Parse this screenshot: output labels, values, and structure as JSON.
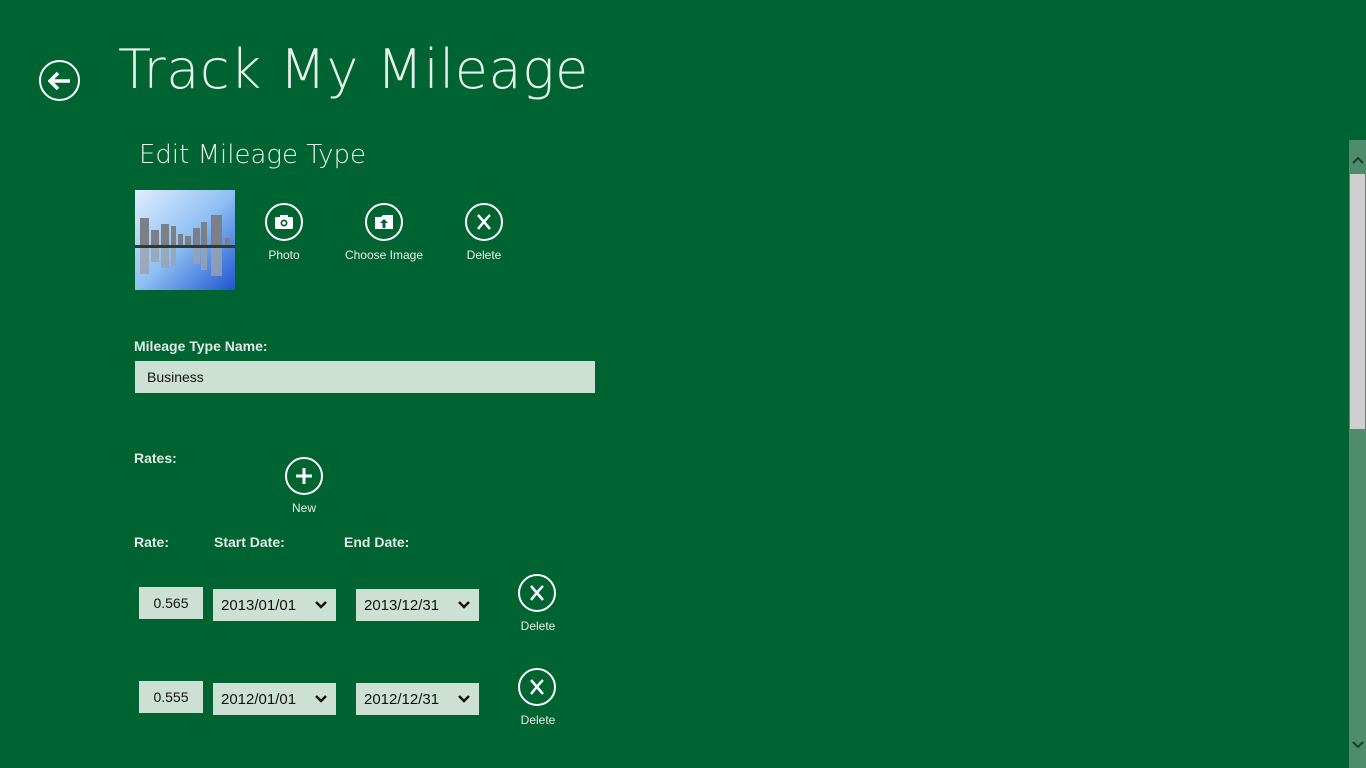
{
  "header": {
    "app_title": "Track My Mileage",
    "back_icon": "back-arrow-icon"
  },
  "page": {
    "section_title": "Edit Mileage Type"
  },
  "image_actions": {
    "thumbnail_alt": "City skyline reflected in water",
    "photo_label": "Photo",
    "choose_image_label": "Choose Image",
    "delete_label": "Delete"
  },
  "form": {
    "name_label": "Mileage Type Name:",
    "name_value": "Business",
    "rates_label": "Rates:",
    "new_label": "New",
    "columns": {
      "rate": "Rate:",
      "start_date": "Start Date:",
      "end_date": "End Date:"
    },
    "rates": [
      {
        "rate": "0.565",
        "start_date": "2013/01/01",
        "end_date": "2013/12/31",
        "delete_label": "Delete"
      },
      {
        "rate": "0.555",
        "start_date": "2012/01/01",
        "end_date": "2012/12/31",
        "delete_label": "Delete"
      }
    ]
  },
  "colors": {
    "background": "#006432",
    "input_fill": "#cce0d4",
    "scrollbar_track": "#4d8c6c",
    "scrollbar_thumb": "#cfcfcf"
  },
  "scrollbar": {
    "position_fraction": 0.0,
    "visible_fraction": 0.4
  }
}
